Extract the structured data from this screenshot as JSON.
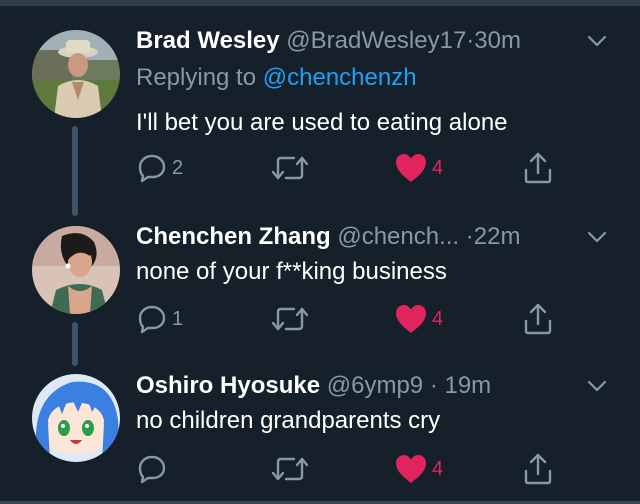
{
  "colors": {
    "background": "#15202b",
    "name": "#ffffff",
    "secondary": "#8899a6",
    "link": "#1da1f2",
    "like": "#e0245e",
    "thread_line": "#3d5466"
  },
  "tweets": [
    {
      "name": "Brad Wesley",
      "handle": "@BradWesley17",
      "time": "30m",
      "replying_prefix": "Replying to",
      "replying_to": "@chenchenzh",
      "text": "I'll bet you are used to eating alone",
      "reply_count": "2",
      "retweet_count": "",
      "like_count": "4",
      "liked": true,
      "avatar_icon": "avatar-photo-man-in-suit"
    },
    {
      "name": "Chenchen Zhang",
      "handle": "@chench...",
      "time": "22m",
      "text": "none of your f**king business",
      "reply_count": "1",
      "retweet_count": "",
      "like_count": "4",
      "liked": true,
      "avatar_icon": "avatar-photo-woman"
    },
    {
      "name": "Oshiro Hyosuke",
      "handle": "@6ymp9",
      "time": "19m",
      "text": "no children grandparents cry",
      "reply_count": "",
      "retweet_count": "",
      "like_count": "4",
      "liked": true,
      "avatar_icon": "avatar-anime-blue-hair"
    }
  ],
  "separator": "·",
  "icons": [
    "reply-icon",
    "retweet-icon",
    "heart-icon",
    "share-icon",
    "chevron-down-icon"
  ]
}
